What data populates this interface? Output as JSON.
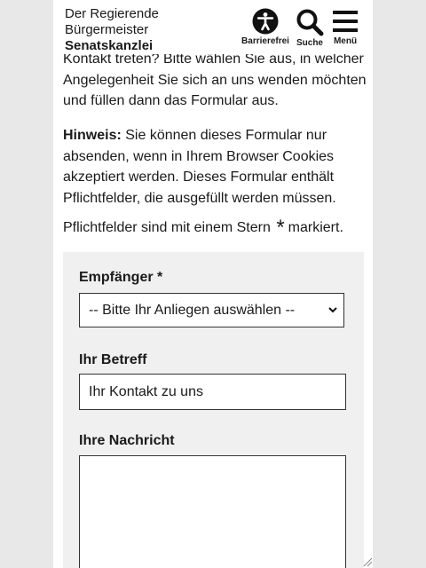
{
  "header": {
    "logo_line1": "Der Regierende",
    "logo_line2": "Bürgermeister",
    "logo_line3": "Senatskanzlei",
    "barrierefrei_label": "Barrierefrei",
    "suche_label": "Suche",
    "menu_label": "Menü"
  },
  "intro": {
    "paragraph1": "Kontakt treten? Bitte wählen Sie aus, in welcher Angelegenheit Sie sich an uns wenden möchten und füllen dann das Formular aus.",
    "hint_label": "Hinweis:",
    "hint_text": " Sie können dieses Formular nur absenden, wenn in Ihrem Browser Cookies akzeptiert werden. Dieses Formular enthält Pflichtfelder, die ausgefüllt werden müssen.",
    "required_pre": "Pflichtfelder sind mit einem Stern",
    "required_star": "*",
    "required_post": "markiert."
  },
  "form": {
    "recipient_label": "Empfänger *",
    "recipient_value": "-- Bitte Ihr Anliegen auswählen --",
    "subject_label": "Ihr Betreff",
    "subject_value": "Ihr Kontakt zu uns",
    "message_label": "Ihre Nachricht",
    "message_value": ""
  },
  "icons": {
    "accessibility": "accessibility-icon",
    "search": "search-icon",
    "menu": "hamburger-menu-icon",
    "select_arrow": "chevron-down-icon"
  }
}
